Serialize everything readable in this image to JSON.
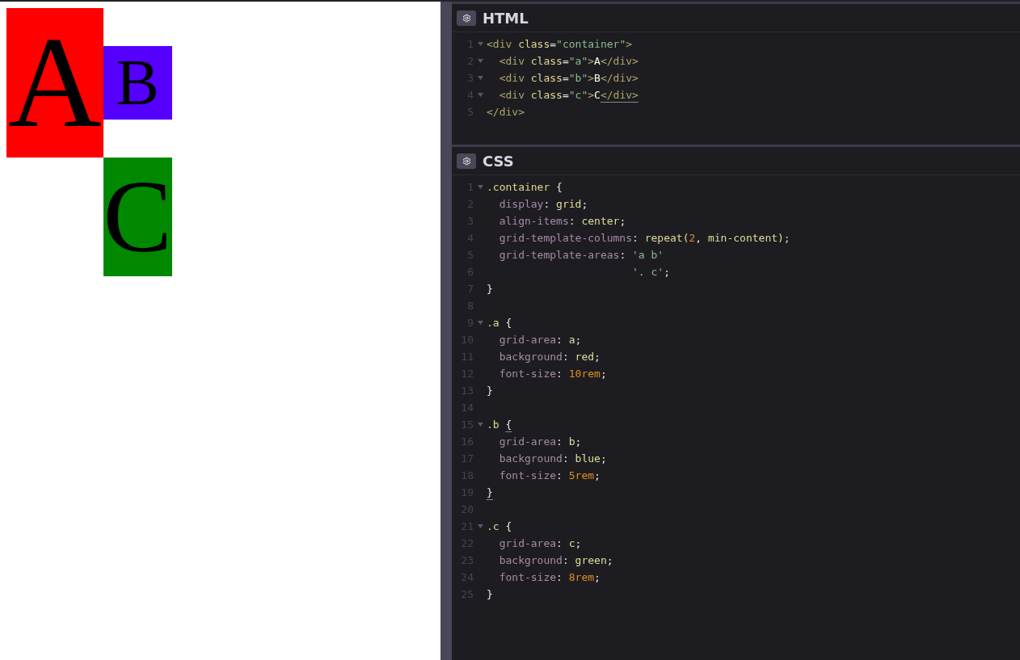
{
  "demo": [
    {
      "letter": "A",
      "color": "#ff0000"
    },
    {
      "letter": "B",
      "color": "#5500ff"
    },
    {
      "letter": "C",
      "color": "#008800"
    }
  ],
  "panels": [
    {
      "title": "HTML",
      "lines": [
        {
          "number": "1",
          "foldable": true,
          "tokens": [
            {
              "text": "<div",
              "kind": "tag",
              "matched": false
            },
            {
              "text": " class",
              "kind": "attr",
              "matched": false
            },
            {
              "text": "=",
              "kind": "punct",
              "matched": false
            },
            {
              "text": "\"container\"",
              "kind": "str",
              "matched": false
            },
            {
              "text": ">",
              "kind": "tag",
              "matched": false
            }
          ]
        },
        {
          "number": "2",
          "foldable": true,
          "tokens": [
            {
              "text": "  <div",
              "kind": "tag",
              "matched": false
            },
            {
              "text": " class",
              "kind": "attr",
              "matched": false
            },
            {
              "text": "=",
              "kind": "punct",
              "matched": false
            },
            {
              "text": "\"a\"",
              "kind": "str",
              "matched": false
            },
            {
              "text": ">",
              "kind": "tag",
              "matched": false
            },
            {
              "text": "A",
              "kind": "text",
              "matched": false
            },
            {
              "text": "</div>",
              "kind": "tag",
              "matched": false
            }
          ]
        },
        {
          "number": "3",
          "foldable": true,
          "tokens": [
            {
              "text": "  <div",
              "kind": "tag",
              "matched": false
            },
            {
              "text": " class",
              "kind": "attr",
              "matched": false
            },
            {
              "text": "=",
              "kind": "punct",
              "matched": false
            },
            {
              "text": "\"b\"",
              "kind": "str",
              "matched": false
            },
            {
              "text": ">",
              "kind": "tag",
              "matched": false
            },
            {
              "text": "B",
              "kind": "text",
              "matched": false
            },
            {
              "text": "</div>",
              "kind": "tag",
              "matched": false
            }
          ]
        },
        {
          "number": "4",
          "foldable": true,
          "tokens": [
            {
              "text": "  <div",
              "kind": "tag",
              "matched": false
            },
            {
              "text": " class",
              "kind": "attr",
              "matched": false
            },
            {
              "text": "=",
              "kind": "punct",
              "matched": false
            },
            {
              "text": "\"c\"",
              "kind": "str",
              "matched": false
            },
            {
              "text": ">",
              "kind": "tag",
              "matched": false
            },
            {
              "text": "C",
              "kind": "text",
              "matched": false
            },
            {
              "text": "</div>",
              "kind": "tag",
              "matched": true
            }
          ]
        },
        {
          "number": "5",
          "foldable": false,
          "tokens": [
            {
              "text": "</div>",
              "kind": "tag",
              "matched": false
            }
          ]
        }
      ]
    },
    {
      "title": "CSS",
      "lines": [
        {
          "number": "1",
          "foldable": true,
          "tokens": [
            {
              "text": ".container",
              "kind": "sel",
              "matched": false
            },
            {
              "text": " {",
              "kind": "punct",
              "matched": false
            }
          ]
        },
        {
          "number": "2",
          "foldable": false,
          "tokens": [
            {
              "text": "  display",
              "kind": "prop",
              "matched": false
            },
            {
              "text": ": ",
              "kind": "punct",
              "matched": false
            },
            {
              "text": "grid",
              "kind": "val",
              "matched": false
            },
            {
              "text": ";",
              "kind": "punct",
              "matched": false
            }
          ]
        },
        {
          "number": "3",
          "foldable": false,
          "tokens": [
            {
              "text": "  align-items",
              "kind": "prop",
              "matched": false
            },
            {
              "text": ": ",
              "kind": "punct",
              "matched": false
            },
            {
              "text": "center",
              "kind": "val",
              "matched": false
            },
            {
              "text": ";",
              "kind": "punct",
              "matched": false
            }
          ]
        },
        {
          "number": "4",
          "foldable": false,
          "tokens": [
            {
              "text": "  grid-template-columns",
              "kind": "prop",
              "matched": false
            },
            {
              "text": ": ",
              "kind": "punct",
              "matched": false
            },
            {
              "text": "repeat(",
              "kind": "val",
              "matched": false
            },
            {
              "text": "2",
              "kind": "num",
              "matched": false
            },
            {
              "text": ", ",
              "kind": "punct",
              "matched": false
            },
            {
              "text": "min-content);",
              "kind": "val",
              "matched": false
            }
          ]
        },
        {
          "number": "5",
          "foldable": false,
          "tokens": [
            {
              "text": "  grid-template-areas",
              "kind": "prop",
              "matched": false
            },
            {
              "text": ": ",
              "kind": "punct",
              "matched": false
            },
            {
              "text": "'a b'",
              "kind": "str",
              "matched": false
            }
          ]
        },
        {
          "number": "6",
          "foldable": false,
          "tokens": [
            {
              "text": "                       '. c'",
              "kind": "str",
              "matched": false
            },
            {
              "text": ";",
              "kind": "punct",
              "matched": false
            }
          ]
        },
        {
          "number": "7",
          "foldable": false,
          "tokens": [
            {
              "text": "}",
              "kind": "punct",
              "matched": false
            }
          ]
        },
        {
          "number": "8",
          "foldable": false
        },
        {
          "number": "9",
          "foldable": true,
          "tokens": [
            {
              "text": ".a",
              "kind": "sel",
              "matched": false
            },
            {
              "text": " {",
              "kind": "punct",
              "matched": false
            }
          ]
        },
        {
          "number": "10",
          "foldable": false,
          "tokens": [
            {
              "text": "  grid-area",
              "kind": "prop",
              "matched": false
            },
            {
              "text": ": ",
              "kind": "punct",
              "matched": false
            },
            {
              "text": "a",
              "kind": "val",
              "matched": false
            },
            {
              "text": ";",
              "kind": "punct",
              "matched": false
            }
          ]
        },
        {
          "number": "11",
          "foldable": false,
          "tokens": [
            {
              "text": "  background",
              "kind": "prop",
              "matched": false
            },
            {
              "text": ": ",
              "kind": "punct",
              "matched": false
            },
            {
              "text": "red",
              "kind": "val",
              "matched": false
            },
            {
              "text": ";",
              "kind": "punct",
              "matched": false
            }
          ]
        },
        {
          "number": "12",
          "foldable": false,
          "tokens": [
            {
              "text": "  font-size",
              "kind": "prop",
              "matched": false
            },
            {
              "text": ": ",
              "kind": "punct",
              "matched": false
            },
            {
              "text": "10rem",
              "kind": "num",
              "matched": false
            },
            {
              "text": ";",
              "kind": "punct",
              "matched": false
            }
          ]
        },
        {
          "number": "13",
          "foldable": false,
          "tokens": [
            {
              "text": "}",
              "kind": "punct",
              "matched": false
            }
          ]
        },
        {
          "number": "14",
          "foldable": false
        },
        {
          "number": "15",
          "foldable": true,
          "tokens": [
            {
              "text": ".b ",
              "kind": "sel",
              "matched": false
            },
            {
              "text": "{",
              "kind": "punct",
              "matched": true
            }
          ]
        },
        {
          "number": "16",
          "foldable": false,
          "tokens": [
            {
              "text": "  grid-area",
              "kind": "prop",
              "matched": false
            },
            {
              "text": ": ",
              "kind": "punct",
              "matched": false
            },
            {
              "text": "b",
              "kind": "val",
              "matched": false
            },
            {
              "text": ";",
              "kind": "punct",
              "matched": false
            }
          ]
        },
        {
          "number": "17",
          "foldable": false,
          "tokens": [
            {
              "text": "  background",
              "kind": "prop",
              "matched": false
            },
            {
              "text": ": ",
              "kind": "punct",
              "matched": false
            },
            {
              "text": "blue",
              "kind": "val",
              "matched": false
            },
            {
              "text": ";",
              "kind": "punct",
              "matched": false
            }
          ]
        },
        {
          "number": "18",
          "foldable": false,
          "tokens": [
            {
              "text": "  font-size",
              "kind": "prop",
              "matched": false
            },
            {
              "text": ": ",
              "kind": "punct",
              "matched": false
            },
            {
              "text": "5rem",
              "kind": "num",
              "matched": false
            },
            {
              "text": ";",
              "kind": "punct",
              "matched": false
            }
          ]
        },
        {
          "number": "19",
          "foldable": false,
          "tokens": [
            {
              "text": "}",
              "kind": "punct",
              "matched": true
            }
          ]
        },
        {
          "number": "20",
          "foldable": false
        },
        {
          "number": "21",
          "foldable": true,
          "tokens": [
            {
              "text": ".c",
              "kind": "sel",
              "matched": false
            },
            {
              "text": " {",
              "kind": "punct",
              "matched": false
            }
          ]
        },
        {
          "number": "22",
          "foldable": false,
          "tokens": [
            {
              "text": "  grid-area",
              "kind": "prop",
              "matched": false
            },
            {
              "text": ": ",
              "kind": "punct",
              "matched": false
            },
            {
              "text": "c",
              "kind": "val",
              "matched": false
            },
            {
              "text": ";",
              "kind": "punct",
              "matched": false
            }
          ]
        },
        {
          "number": "23",
          "foldable": false,
          "tokens": [
            {
              "text": "  background",
              "kind": "prop",
              "matched": false
            },
            {
              "text": ": ",
              "kind": "punct",
              "matched": false
            },
            {
              "text": "green",
              "kind": "val",
              "matched": false
            },
            {
              "text": ";",
              "kind": "punct",
              "matched": false
            }
          ]
        },
        {
          "number": "24",
          "foldable": false,
          "tokens": [
            {
              "text": "  font-size",
              "kind": "prop",
              "matched": false
            },
            {
              "text": ": ",
              "kind": "punct",
              "matched": false
            },
            {
              "text": "8rem",
              "kind": "num",
              "matched": false
            },
            {
              "text": ";",
              "kind": "punct",
              "matched": false
            }
          ]
        },
        {
          "number": "25",
          "foldable": false,
          "tokens": [
            {
              "text": "}",
              "kind": "punct",
              "matched": false
            }
          ]
        }
      ]
    }
  ]
}
